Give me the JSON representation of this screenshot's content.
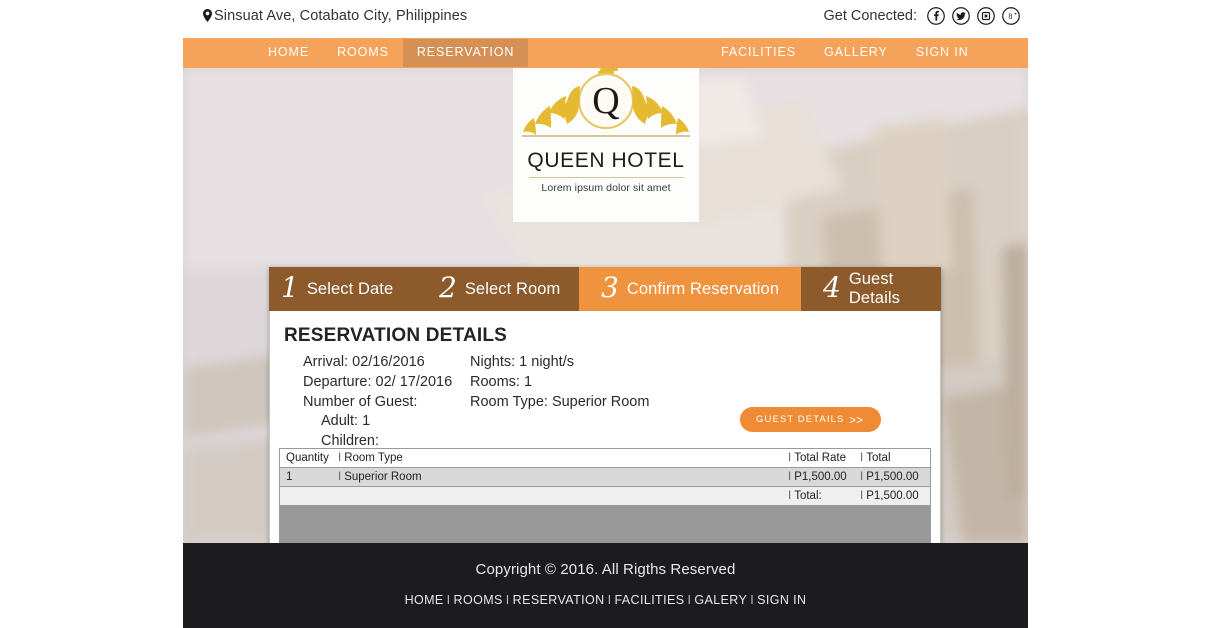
{
  "topbar": {
    "address": "Sinsuat Ave, Cotabato City, Philippines",
    "pin_icon": "location-pin-icon",
    "connect_label": "Get Conected:",
    "social": [
      {
        "name": "facebook-icon",
        "glyph": "f"
      },
      {
        "name": "twitter-icon",
        "glyph": "t"
      },
      {
        "name": "instagram-icon",
        "glyph": "i"
      },
      {
        "name": "googleplus-icon",
        "glyph": "g+"
      }
    ]
  },
  "nav": {
    "left_items": [
      {
        "label": "HOME",
        "active": false
      },
      {
        "label": "ROOMS",
        "active": false
      },
      {
        "label": "RESERVATION",
        "active": true
      }
    ],
    "right_items": [
      {
        "label": "FACILITIES",
        "active": false
      },
      {
        "label": "GALLERY",
        "active": false
      },
      {
        "label": "SIGN IN",
        "active": false
      }
    ],
    "bg_color": "#f5a25a"
  },
  "logo": {
    "monogram": "Q",
    "title": "QUEEN HOTEL",
    "subtitle": "Lorem ipsum dolor sit amet"
  },
  "steps": [
    {
      "number": "1",
      "label": "Select Date",
      "state": "dark"
    },
    {
      "number": "2",
      "label": "Select Room",
      "state": "dark"
    },
    {
      "number": "3",
      "label": "Confirm Reservation",
      "state": "light"
    },
    {
      "number": "4",
      "label": "Guest Details",
      "state": "dark"
    }
  ],
  "panel": {
    "title": "RESERVATION DETAILS",
    "left_lines": [
      "Arrival: 02/16/2016",
      "Departure: 02/ 17/2016",
      "Number of Guest:"
    ],
    "left_sub_lines": [
      "Adult: 1",
      "Children:"
    ],
    "right_lines": [
      "Nights: 1 night/s",
      "Rooms: 1",
      "Room Type: Superior Room"
    ],
    "guest_button": {
      "label": "GUEST DETAILS",
      "arrow": ">>"
    }
  },
  "table": {
    "headers": {
      "quantity": "Quantity",
      "room_type": "Room Type",
      "total_rate": "Total Rate",
      "total": "Total"
    },
    "separator": "I",
    "rows": [
      {
        "quantity": "1",
        "room_type": "Superior Room",
        "total_rate": "P1,500.00",
        "total": "P1,500.00"
      }
    ],
    "total_row": {
      "label": "Total:",
      "value": "P1,500.00"
    }
  },
  "footer": {
    "copyright": "Copyright © 2016. All Rigths Reserved",
    "links": [
      "HOME",
      "ROOMS",
      "RESERVATION",
      "FACILITIES",
      "GALERY",
      "SIGN IN"
    ],
    "separator": "I"
  },
  "colors": {
    "nav_orange": "#f5a25a",
    "step_dark": "#8c5a2b",
    "step_light": "#f0933f",
    "button_orange": "#ef8b35",
    "footer_bg": "#1c1c1e"
  }
}
